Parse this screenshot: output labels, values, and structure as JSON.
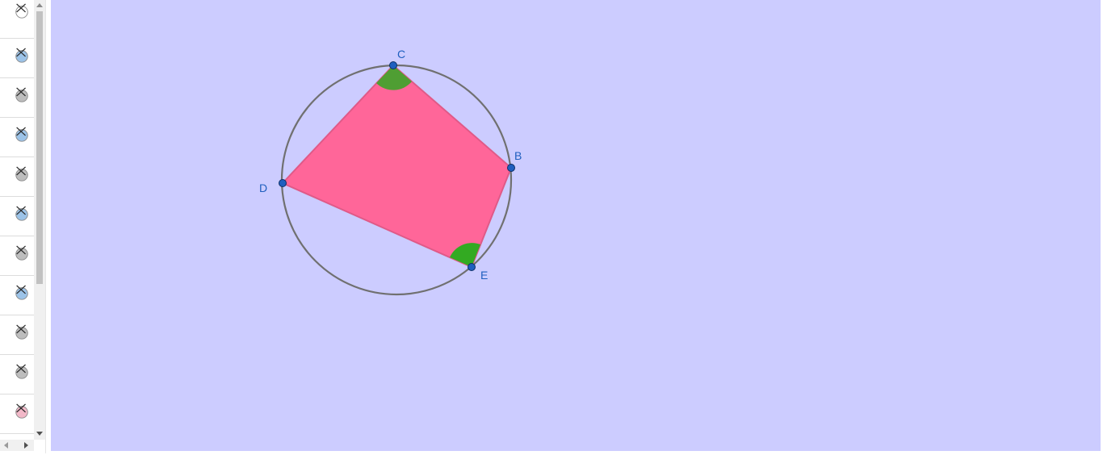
{
  "app": {
    "colors": {
      "graphics_background": "#ccccff",
      "polygon_fill": "#ff6699",
      "polygon_stroke": "#e05a88",
      "circle_stroke": "#707070",
      "point_fill": "#1f5fbf",
      "angle_fill_c": "#4f9e33",
      "angle_fill_e": "#33aa22",
      "label_color": "#1f5fbf"
    }
  },
  "algebra_view": {
    "rows": [
      {
        "icon": "visibility-toggle-icon",
        "state_color": "#ffffff"
      },
      {
        "icon": "visibility-toggle-icon",
        "state_color": "#9cc3e8"
      },
      {
        "icon": "visibility-toggle-icon",
        "state_color": "#bdbdbd"
      },
      {
        "icon": "visibility-toggle-icon",
        "state_color": "#9cc3e8"
      },
      {
        "icon": "visibility-toggle-icon",
        "state_color": "#bdbdbd"
      },
      {
        "icon": "visibility-toggle-icon",
        "state_color": "#9cc3e8"
      },
      {
        "icon": "visibility-toggle-icon",
        "state_color": "#bdbdbd"
      },
      {
        "icon": "visibility-toggle-icon",
        "state_color": "#9cc3e8"
      },
      {
        "icon": "visibility-toggle-icon",
        "state_color": "#bdbdbd"
      },
      {
        "icon": "visibility-toggle-icon",
        "state_color": "#bdbdbd"
      },
      {
        "icon": "visibility-toggle-icon",
        "state_color": "#f2b8c8"
      }
    ]
  },
  "graphics_view": {
    "points": {
      "C": "C",
      "B": "B",
      "D": "D",
      "E": "E"
    }
  }
}
